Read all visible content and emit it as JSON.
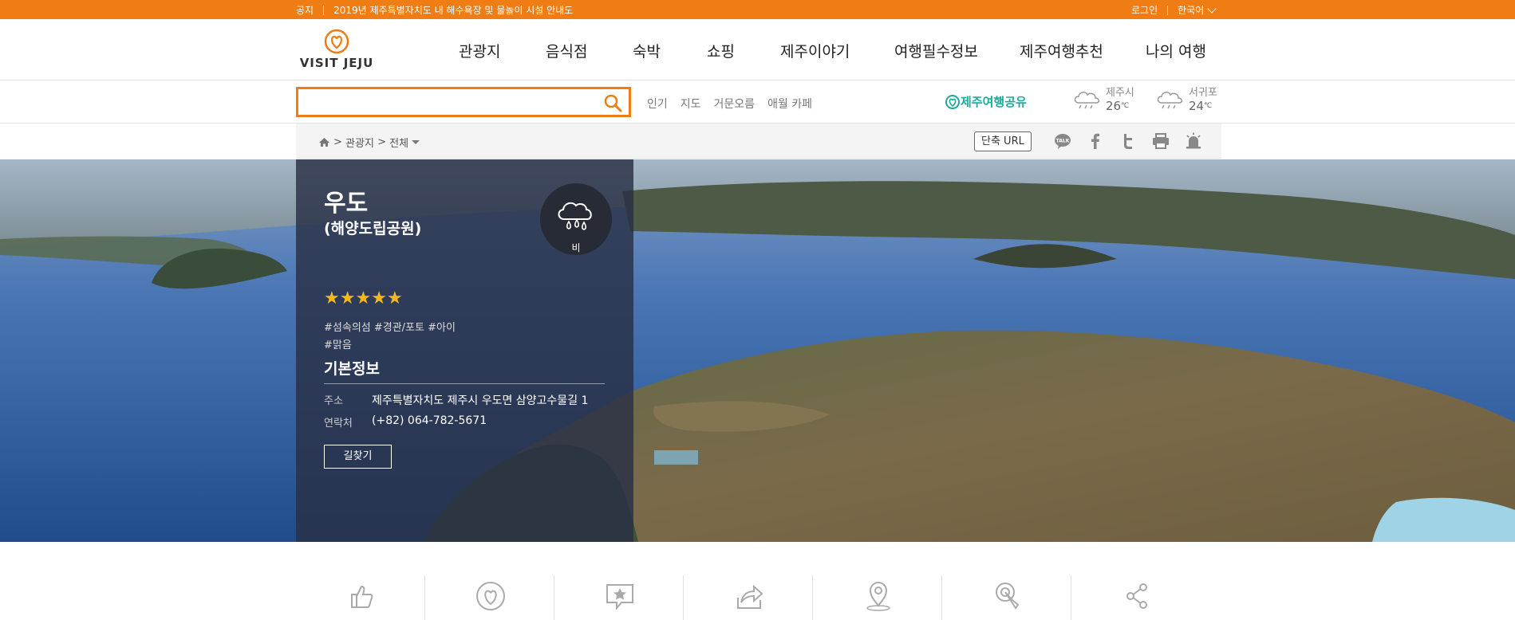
{
  "topbar": {
    "notice_label": "공지",
    "notice_text": "2019년 제주특별자치도 내 해수욕장 및 물놀이 시설 안내도",
    "login": "로그인",
    "language": "한국어"
  },
  "logo": {
    "text": "VISIT JEJU"
  },
  "gnb": [
    "관광지",
    "음식점",
    "숙박",
    "쇼핑",
    "제주이야기",
    "여행필수정보",
    "제주여행추천",
    "나의 여행"
  ],
  "search": {
    "placeholder": "",
    "quick_links": [
      "인기",
      "지도",
      "거문오름",
      "애월 카페"
    ]
  },
  "share_logo": "제주여행공유",
  "weather": [
    {
      "city": "제주시",
      "temp": "26",
      "unit": "℃"
    },
    {
      "city": "서귀포",
      "temp": "24",
      "unit": "℃"
    }
  ],
  "breadcrumb": {
    "level1": "관광지",
    "level2": "전체",
    "separator": ">"
  },
  "short_url_button": "단축 URL",
  "share_icons": [
    "kakaotalk-icon",
    "facebook-icon",
    "twitter-icon",
    "print-icon",
    "alert-icon"
  ],
  "place": {
    "title": "우도",
    "subtitle": "(해양도립공원)",
    "weather_label": "비",
    "rating": 5,
    "tags_line1": "#섬속의섬 #경관/포토 #아이",
    "tags_line2": "#맑음",
    "section_title": "기본정보",
    "address_label": "주소",
    "address": "제주특별자치도 제주시 우도면 삼양고수물길 1",
    "phone_label": "연락처",
    "phone": "(+82) 064-782-5671",
    "directions_button": "길찾기"
  },
  "bottom_icons": [
    "like-icon",
    "heart-icon",
    "review-icon",
    "share-arrow-icon",
    "location-icon",
    "click-icon",
    "share-icon"
  ],
  "colors": {
    "accent": "#f07d14",
    "share_green": "#1aab9b",
    "star": "#f5b81c"
  }
}
